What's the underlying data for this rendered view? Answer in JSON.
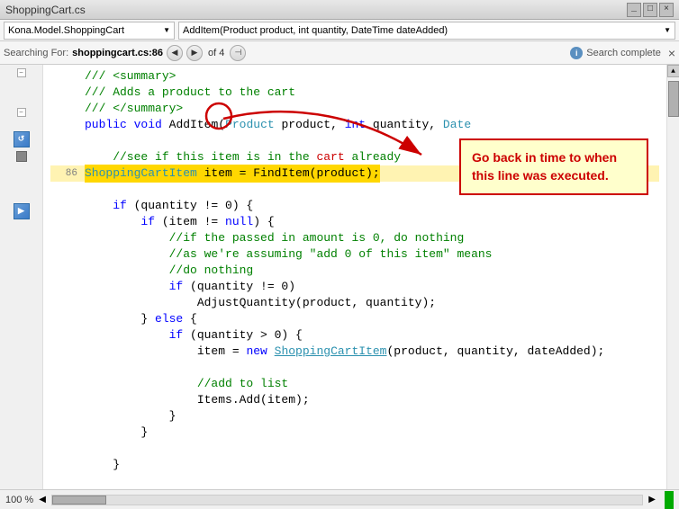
{
  "titlebar": {
    "filename": "ShoppingCart.cs",
    "controls": [
      "_",
      "□",
      "×"
    ]
  },
  "navbar": {
    "left_value": "Kona.Model.ShoppingCart",
    "right_value": "AddItem(Product product, int quantity, DateTime dateAdded)"
  },
  "searchbar": {
    "label": "Searching For:",
    "value": "shoppingcart.cs:86",
    "count": "of 4",
    "status": "Search complete",
    "close": "×"
  },
  "tooltip": {
    "text": "Go back in time to when this line was executed."
  },
  "code": {
    "lines": [
      {
        "num": "",
        "content": ""
      },
      {
        "num": "",
        "content": "      /// <summary>"
      },
      {
        "num": "",
        "content": "      /// Adds a product to the cart"
      },
      {
        "num": "",
        "content": "      /// </summary>"
      },
      {
        "num": "",
        "content": "      public void AddItem(Product product, int quantity, Date"
      },
      {
        "num": "",
        "content": ""
      },
      {
        "num": "",
        "content": "          //see if this item is in the cart already"
      },
      {
        "num": "86",
        "content": "          ShoppingCartItem item = FindItem(product);"
      },
      {
        "num": "",
        "content": ""
      },
      {
        "num": "",
        "content": "          if (quantity != 0) {"
      },
      {
        "num": "",
        "content": "              if (item != null) {"
      },
      {
        "num": "",
        "content": "                  //if the passed in amount is 0, do nothing"
      },
      {
        "num": "",
        "content": "                  //as we're assuming \"add 0 of this item\" means"
      },
      {
        "num": "",
        "content": "                  //do nothing"
      },
      {
        "num": "",
        "content": "                  if (quantity != 0)"
      },
      {
        "num": "",
        "content": "                      AdjustQuantity(product, quantity);"
      },
      {
        "num": "",
        "content": "              } else {"
      },
      {
        "num": "",
        "content": "                  if (quantity > 0) {"
      },
      {
        "num": "",
        "content": "                      item = new ShoppingCartItem(product, quantity, dateAdded);"
      },
      {
        "num": "",
        "content": ""
      },
      {
        "num": "",
        "content": "                      //add to list"
      },
      {
        "num": "",
        "content": "                      Items.Add(item);"
      },
      {
        "num": "",
        "content": "                  }"
      },
      {
        "num": "",
        "content": "              }"
      },
      {
        "num": "",
        "content": ""
      },
      {
        "num": "",
        "content": "          }"
      },
      {
        "num": "",
        "content": ""
      },
      {
        "num": "",
        "content": "      }"
      }
    ]
  },
  "bottombar": {
    "zoom": "100 %"
  }
}
